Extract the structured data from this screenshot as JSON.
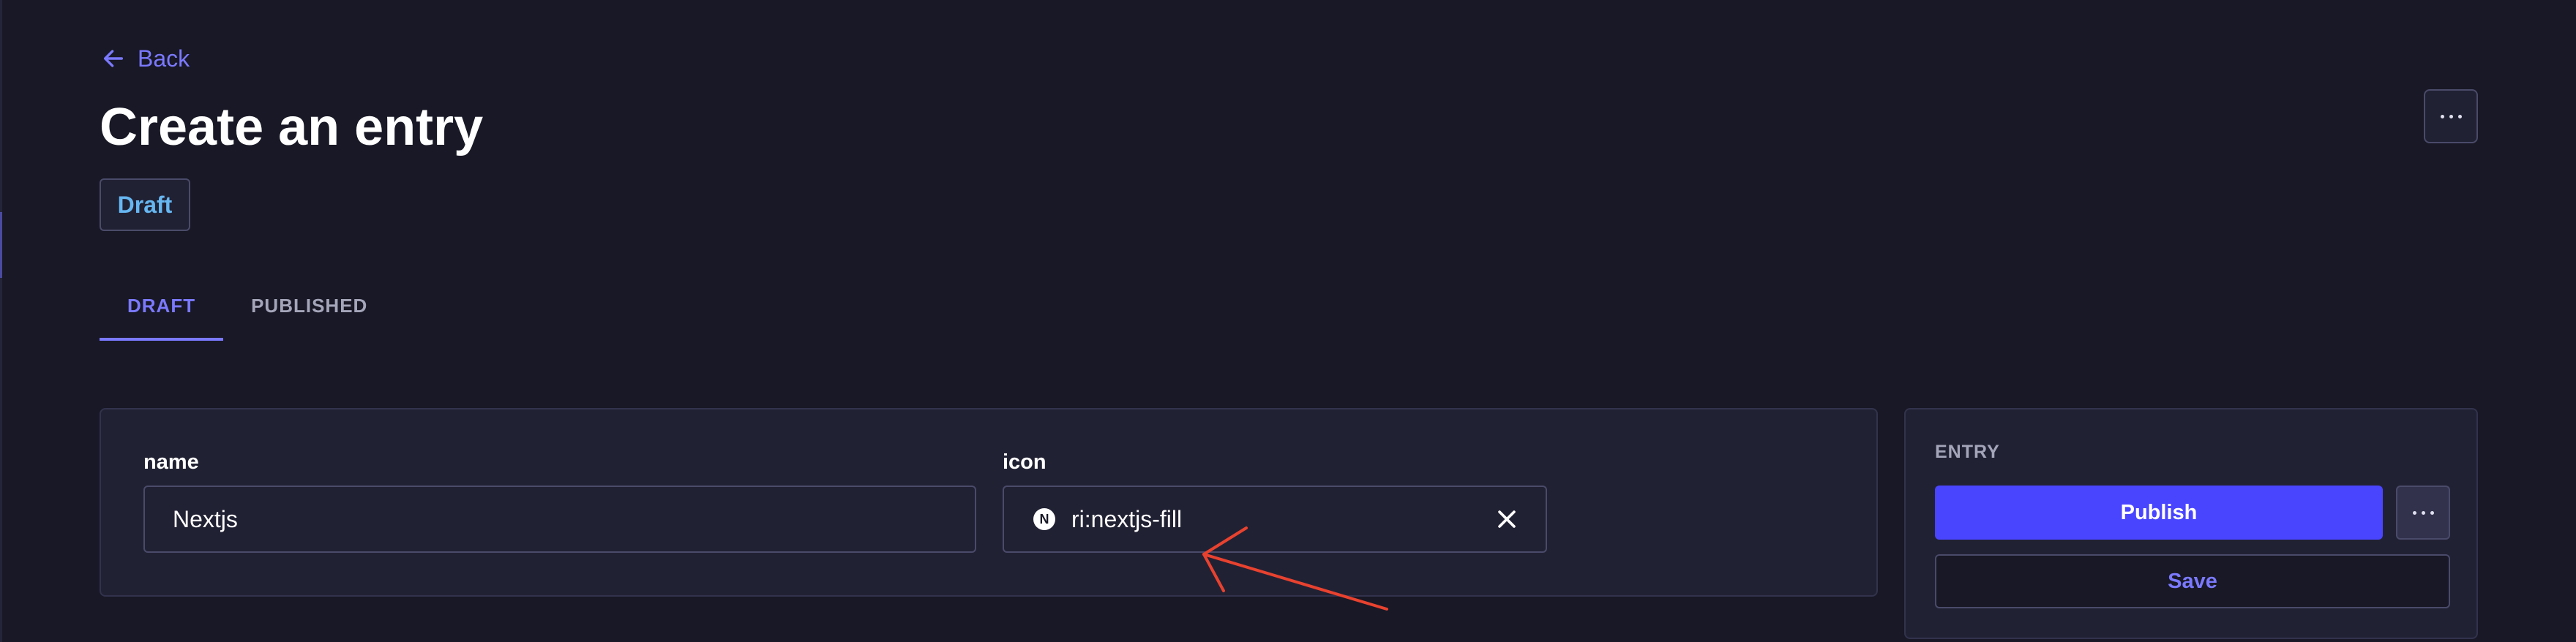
{
  "colors": {
    "background": "#181826",
    "card": "#212134",
    "border": "#4a4a6a",
    "accent": "#7b79ff",
    "primary_button": "#4945ff",
    "badge_text": "#66b7f1",
    "annotation": "#e8422f"
  },
  "header": {
    "back_label": "Back",
    "back_icon": "arrow-left-icon",
    "title": "Create an entry",
    "more_icon": "more-horizontal-icon"
  },
  "status_badge": "Draft",
  "tabs": [
    {
      "label": "DRAFT",
      "active": true
    },
    {
      "label": "PUBLISHED",
      "active": false
    }
  ],
  "form": {
    "name": {
      "label": "name",
      "value": "Nextjs"
    },
    "icon": {
      "label": "icon",
      "value": "ri:nextjs-fill",
      "glyph": "N",
      "preview_icon": "nextjs-icon",
      "clear_icon": "close-icon"
    }
  },
  "entry_panel": {
    "title": "ENTRY",
    "publish_label": "Publish",
    "save_label": "Save",
    "more_icon": "more-horizontal-icon"
  }
}
